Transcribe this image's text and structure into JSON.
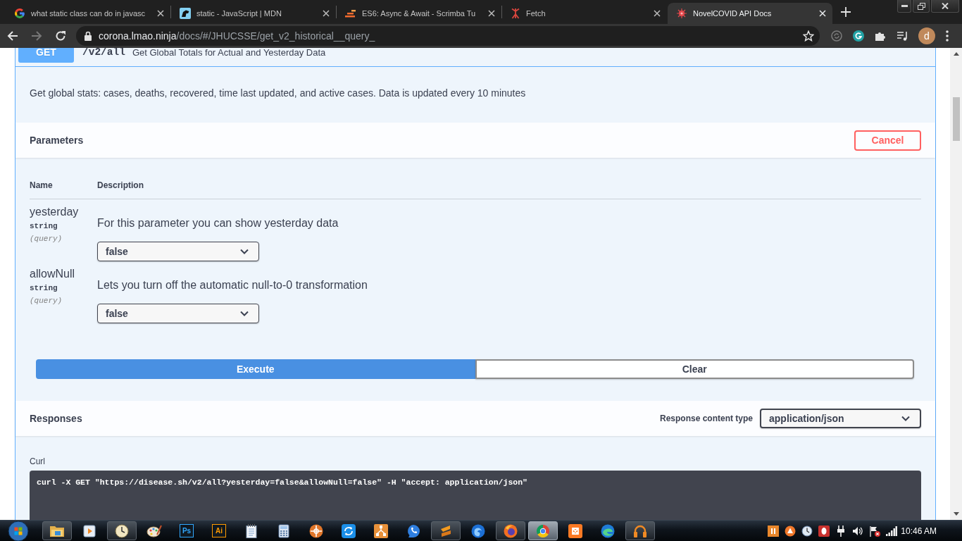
{
  "browser": {
    "tabs": [
      {
        "kind": "google",
        "title": "what static class can do in javasc",
        "selected": false
      },
      {
        "kind": "mdn",
        "title": "static - JavaScript | MDN",
        "selected": false
      },
      {
        "kind": "scrimba",
        "title": "ES6: Async & Await - Scrimba Tu",
        "selected": false
      },
      {
        "kind": "fetch",
        "title": "Fetch",
        "selected": false
      },
      {
        "kind": "covid",
        "title": "NovelCOVID API Docs",
        "selected": true
      }
    ],
    "address": {
      "host": "corona.lmao.ninja",
      "path": "/docs/#/JHUCSSE/get_v2_historical__query_"
    },
    "profile_initial": "d"
  },
  "operation": {
    "method": "GET",
    "path": "/v2/all",
    "summary": "Get Global Totals for Actual and Yesterday Data",
    "description": "Get global stats: cases, deaths, recovered, time last updated, and active cases. Data is updated every 10 minutes"
  },
  "parameters": {
    "title": "Parameters",
    "cancel": "Cancel",
    "columns": [
      "Name",
      "Description"
    ],
    "rows": [
      {
        "name": "yesterday",
        "type": "string",
        "location": "(query)",
        "description": "For this parameter you can show yesterday data",
        "value": "false"
      },
      {
        "name": "allowNull",
        "type": "string",
        "location": "(query)",
        "description": "Lets you turn off the automatic null-to-0 transformation",
        "value": "false"
      }
    ]
  },
  "actions": [
    {
      "label": "Execute",
      "kind": "primary"
    },
    {
      "label": "Clear",
      "kind": "secondary"
    }
  ],
  "responses": {
    "title": "Responses",
    "content_type_label": "Response content type",
    "content_type": "application/json",
    "curl_label": "Curl",
    "curl": "curl -X GET \"https://disease.sh/v2/all?yesterday=false&allowNull=false\" -H \"accept: application/json\""
  },
  "taskbar": {
    "apps": [
      {
        "kind": "folder",
        "open": true,
        "active": false
      },
      {
        "kind": "player",
        "open": false,
        "active": false
      },
      {
        "kind": "clock",
        "open": true,
        "active": false
      },
      {
        "kind": "palette",
        "open": false,
        "active": false
      },
      {
        "kind": "logo",
        "label": "Ps",
        "color": "#31a8ff",
        "open": false,
        "active": false
      },
      {
        "kind": "logo",
        "label": "Ai",
        "color": "#ff9a00",
        "open": false,
        "active": false
      },
      {
        "kind": "notepad",
        "open": false,
        "active": false
      },
      {
        "kind": "calculator",
        "open": false,
        "active": false
      },
      {
        "kind": "crosshair",
        "open": false,
        "active": false
      },
      {
        "kind": "sync",
        "open": false,
        "active": false
      },
      {
        "kind": "network",
        "open": false,
        "active": false
      },
      {
        "kind": "phone",
        "open": false,
        "active": false
      },
      {
        "kind": "zigzag",
        "open": true,
        "active": false
      },
      {
        "kind": "swirl",
        "open": false,
        "active": false
      },
      {
        "kind": "fox",
        "open": true,
        "active": false
      },
      {
        "kind": "segments",
        "open": true,
        "active": true
      },
      {
        "kind": "knot",
        "open": false,
        "active": false
      },
      {
        "kind": "wave",
        "open": false,
        "active": false
      },
      {
        "kind": "headphones",
        "open": true,
        "active": false
      }
    ],
    "clock": "10:46 AM"
  }
}
